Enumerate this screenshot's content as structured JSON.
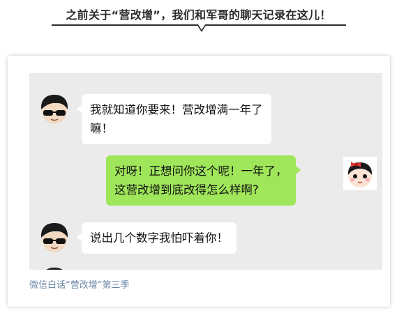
{
  "heading": {
    "title": "之前关于“营改增”，我们和军哥的聊天记录在这儿！"
  },
  "chat": {
    "messages": [
      {
        "sender": "军哥",
        "side": "left",
        "avatar_icon": "boy-sunglasses-avatar-icon",
        "lines": [
          "我就知道你要来！营改增满一年了",
          "嘛！"
        ]
      },
      {
        "sender": "me",
        "side": "right",
        "avatar_icon": "girl-bow-avatar-icon",
        "lines": [
          "对呀！正想问你这个呢！一年了，",
          "这营改增到底改得怎么样啊?"
        ]
      },
      {
        "sender": "军哥",
        "side": "left",
        "avatar_icon": "boy-sunglasses-avatar-icon",
        "lines": [
          "说出几个数字我怕吓着你！"
        ]
      }
    ],
    "bubble_colors": {
      "incoming": "#ffffff",
      "outgoing": "#9fe65a",
      "background": "#ebebeb"
    }
  },
  "caption": "微信白话“营改增”第三季",
  "colors": {
    "caption_text": "#6d8aa8",
    "heading_text": "#2b2b2b"
  }
}
